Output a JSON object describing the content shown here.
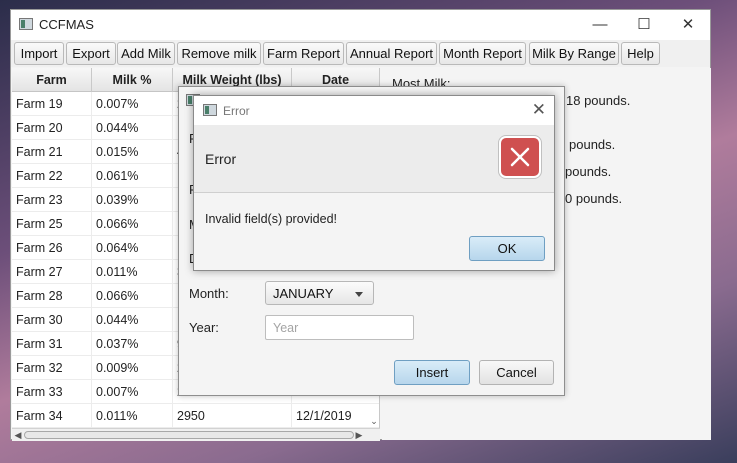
{
  "window": {
    "title": "CCFMAS"
  },
  "menu": [
    "Import",
    "Export",
    "Add Milk",
    "Remove milk",
    "Farm Report",
    "Annual Report",
    "Month Report",
    "Milk By Range",
    "Help"
  ],
  "table": {
    "columns": [
      "Farm",
      "Milk %",
      "Milk Weight (lbs)",
      "Date"
    ],
    "rows": [
      [
        "Farm 19",
        "0.007%",
        "2",
        ""
      ],
      [
        "Farm 20",
        "0.044%",
        "",
        ""
      ],
      [
        "Farm 21",
        "0.015%",
        "4",
        ""
      ],
      [
        "Farm 22",
        "0.061%",
        "",
        ""
      ],
      [
        "Farm 23",
        "0.039%",
        "",
        ""
      ],
      [
        "Farm 25",
        "0.066%",
        "",
        ""
      ],
      [
        "Farm 26",
        "0.064%",
        "",
        ""
      ],
      [
        "Farm 27",
        "0.011%",
        "3",
        ""
      ],
      [
        "Farm 28",
        "0.066%",
        "",
        ""
      ],
      [
        "Farm 30",
        "0.044%",
        "",
        ""
      ],
      [
        "Farm 31",
        "0.037%",
        "9",
        ""
      ],
      [
        "Farm 32",
        "0.009%",
        "2",
        ""
      ],
      [
        "Farm 33",
        "0.007%",
        "2",
        ""
      ],
      [
        "Farm 34",
        "0.011%",
        "2950",
        "12/1/2019"
      ]
    ]
  },
  "stats_panel": {
    "heading": "Most Milk:",
    "lines": [
      "18 pounds.",
      "pounds.",
      "pounds.",
      "0 pounds."
    ]
  },
  "insert_dialog": {
    "partial_labels": [
      "F",
      "F",
      "M",
      "D"
    ],
    "month_label": "Month:",
    "month_value": "JANUARY",
    "year_label": "Year:",
    "year_placeholder": "Year",
    "insert_label": "Insert",
    "cancel_label": "Cancel"
  },
  "error_dialog": {
    "title": "Error",
    "header": "Error",
    "message": "Invalid field(s) provided!",
    "ok_label": "OK",
    "icon": "error-x-icon",
    "accent_color": "#cf5050"
  }
}
